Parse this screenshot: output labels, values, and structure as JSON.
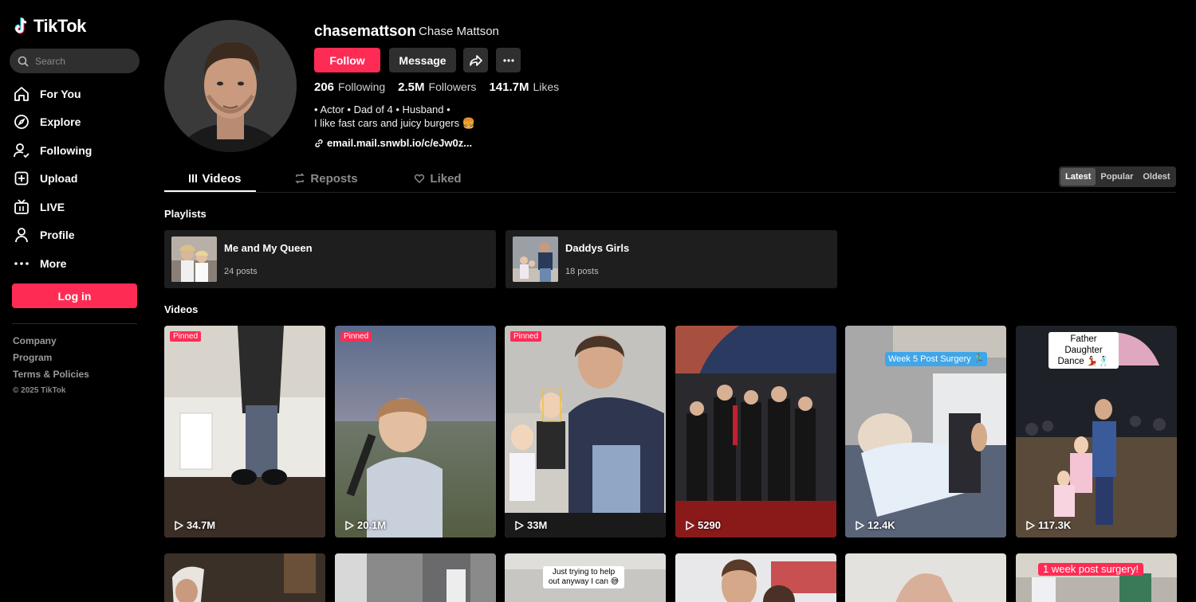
{
  "sidebar": {
    "logo_text": "TikTok",
    "search_placeholder": "Search",
    "nav": [
      {
        "label": "For You",
        "icon": "home-icon"
      },
      {
        "label": "Explore",
        "icon": "compass-icon"
      },
      {
        "label": "Following",
        "icon": "following-icon"
      },
      {
        "label": "Upload",
        "icon": "upload-icon"
      },
      {
        "label": "LIVE",
        "icon": "live-icon"
      },
      {
        "label": "Profile",
        "icon": "profile-icon"
      },
      {
        "label": "More",
        "icon": "more-dots-icon"
      }
    ],
    "login_label": "Log in",
    "footer": {
      "company": "Company",
      "program": "Program",
      "terms": "Terms & Policies",
      "copyright": "© 2025 TikTok"
    }
  },
  "profile": {
    "username": "chasemattson",
    "display_name": "Chase Mattson",
    "follow_label": "Follow",
    "message_label": "Message",
    "following_count": "206",
    "following_label": "Following",
    "followers_count": "2.5M",
    "followers_label": "Followers",
    "likes_count": "141.7M",
    "likes_label": "Likes",
    "bio_line1": "• Actor • Dad of 4 • Husband •",
    "bio_line2": "I like fast cars and juicy burgers 🍔",
    "link": "email.mail.snwbl.io/c/eJw0z..."
  },
  "tabs": [
    {
      "label": "Videos",
      "icon": "grid-icon",
      "active": true
    },
    {
      "label": "Reposts",
      "icon": "repost-icon",
      "active": false
    },
    {
      "label": "Liked",
      "icon": "heart-outline-icon",
      "active": false
    }
  ],
  "sort": {
    "options": [
      "Latest",
      "Popular",
      "Oldest"
    ],
    "selected": "Latest"
  },
  "playlists_title": "Playlists",
  "playlists": [
    {
      "name": "Me and My Queen",
      "count": "24 posts"
    },
    {
      "name": "Daddys Girls",
      "count": "18 posts"
    }
  ],
  "videos_title": "Videos",
  "pinned_label": "Pinned",
  "videos": [
    {
      "views": "34.7M",
      "pinned": true
    },
    {
      "views": "20.1M",
      "pinned": true
    },
    {
      "views": "33M",
      "pinned": true
    },
    {
      "views": "5290",
      "pinned": false
    },
    {
      "views": "12.4K",
      "pinned": false,
      "caption": "Week 5 Post Surgery 🏃‍♂️"
    },
    {
      "views": "117.3K",
      "pinned": false,
      "caption": "Father Daughter Dance 💃🏻🕺🏻"
    }
  ],
  "videos_row2_captions": [
    "Just trying to help out anyway I can 😅",
    "1 week post surgery!"
  ],
  "colors": {
    "accent": "#fe2c55",
    "bg": "#000000",
    "surface": "#2f2f2f"
  }
}
